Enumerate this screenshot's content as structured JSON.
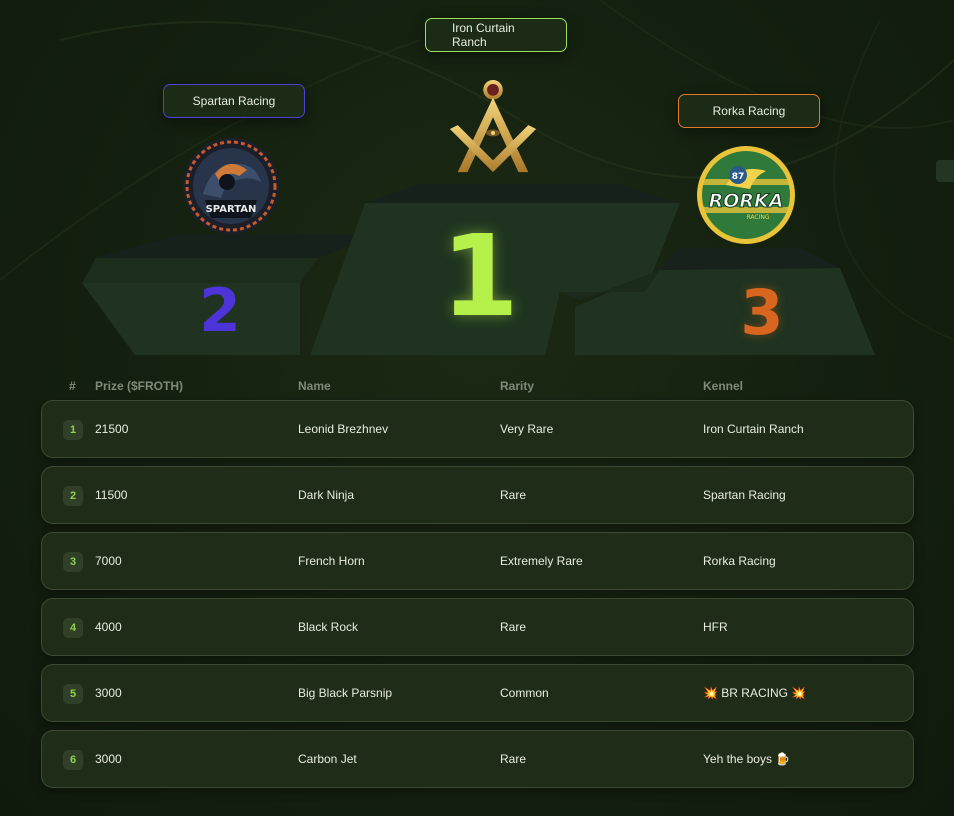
{
  "podium": {
    "first": {
      "kennel": "Iron Curtain Ranch",
      "rank": "1"
    },
    "second": {
      "kennel": "Spartan Racing",
      "rank": "2",
      "logo_text": "SPARTAN"
    },
    "third": {
      "kennel": "Rorka Racing",
      "rank": "3",
      "logo_text": "RORKA",
      "logo_number": "87",
      "logo_sub": "RACING"
    }
  },
  "table": {
    "headers": {
      "rank": "#",
      "prize": "Prize ($FROTH)",
      "name": "Name",
      "rarity": "Rarity",
      "kennel": "Kennel"
    },
    "rows": [
      {
        "rank": "1",
        "prize": "21500",
        "name": "Leonid Brezhnev",
        "rarity": "Very Rare",
        "kennel": "Iron Curtain Ranch"
      },
      {
        "rank": "2",
        "prize": "11500",
        "name": "Dark Ninja",
        "rarity": "Rare",
        "kennel": "Spartan Racing"
      },
      {
        "rank": "3",
        "prize": "7000",
        "name": "French Horn",
        "rarity": "Extremely Rare",
        "kennel": "Rorka Racing"
      },
      {
        "rank": "4",
        "prize": "4000",
        "name": "Black Rock",
        "rarity": "Rare",
        "kennel": "HFR"
      },
      {
        "rank": "5",
        "prize": "3000",
        "name": "Big Black Parsnip",
        "rarity": "Common",
        "kennel": "💥 BR RACING 💥"
      },
      {
        "rank": "6",
        "prize": "3000",
        "name": "Carbon Jet",
        "rarity": "Rare",
        "kennel": "Yeh the boys 🍺"
      }
    ]
  },
  "colors": {
    "first": "#b6f04a",
    "second": "#4c34d8",
    "third": "#d9661f"
  }
}
